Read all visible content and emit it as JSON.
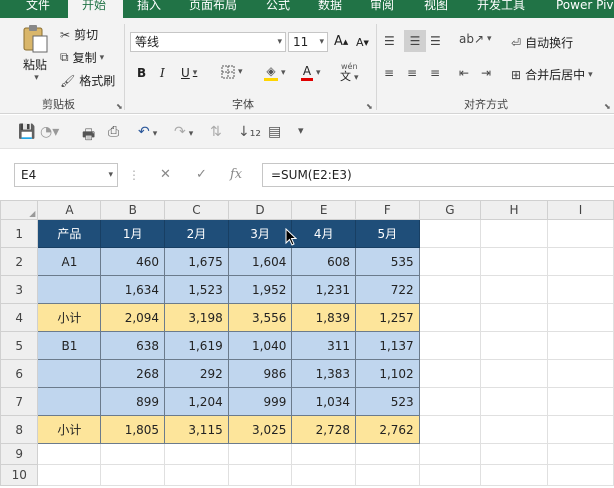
{
  "tabs": [
    "文件",
    "开始",
    "插入",
    "页面布局",
    "公式",
    "数据",
    "审阅",
    "视图",
    "开发工具",
    "Power Piv"
  ],
  "active_tab": "开始",
  "ribbon": {
    "clipboard": {
      "paste": "粘贴",
      "cut": "剪切",
      "copy": "复制",
      "format_painter": "格式刷",
      "group_label": "剪贴板"
    },
    "font": {
      "font_name": "等线",
      "font_size": "11",
      "bold": "B",
      "italic": "I",
      "underline": "U",
      "grow": "A",
      "shrink": "A",
      "font_color": "A",
      "phonetic": "wén",
      "group_label": "字体"
    },
    "alignment": {
      "wrap_text": "自动换行",
      "merge_center": "合并后居中",
      "group_label": "对齐方式"
    }
  },
  "formula_bar": {
    "name_box": "E4",
    "fx": "fx",
    "formula": "=SUM(E2:E3)"
  },
  "sheet": {
    "columns": [
      "A",
      "B",
      "C",
      "D",
      "E",
      "F",
      "G",
      "H",
      "I"
    ],
    "row_numbers": [
      "1",
      "2",
      "3",
      "4",
      "5",
      "6",
      "7",
      "8",
      "9",
      "10"
    ],
    "header_row": [
      "产品",
      "1月",
      "2月",
      "3月",
      "4月",
      "5月"
    ],
    "rows": [
      {
        "label": "A1",
        "values": [
          "460",
          "1,675",
          "1,604",
          "608",
          "535"
        ],
        "style": "bl"
      },
      {
        "label": "",
        "values": [
          "1,634",
          "1,523",
          "1,952",
          "1,231",
          "722"
        ],
        "style": "bl"
      },
      {
        "label": "小计",
        "values": [
          "2,094",
          "3,198",
          "3,556",
          "1,839",
          "1,257"
        ],
        "style": "yl"
      },
      {
        "label": "B1",
        "values": [
          "638",
          "1,619",
          "1,040",
          "311",
          "1,137"
        ],
        "style": "bl"
      },
      {
        "label": "",
        "values": [
          "268",
          "292",
          "986",
          "1,383",
          "1,102"
        ],
        "style": "bl"
      },
      {
        "label": "",
        "values": [
          "899",
          "1,204",
          "999",
          "1,034",
          "523"
        ],
        "style": "bl"
      },
      {
        "label": "小计",
        "values": [
          "1,805",
          "3,115",
          "3,025",
          "2,728",
          "2,762"
        ],
        "style": "yl"
      }
    ]
  },
  "colors": {
    "ribbon_green": "#217346",
    "header_fill": "#1f4e79",
    "data_fill": "#c0d6ee",
    "subtotal_fill": "#fde59b"
  }
}
